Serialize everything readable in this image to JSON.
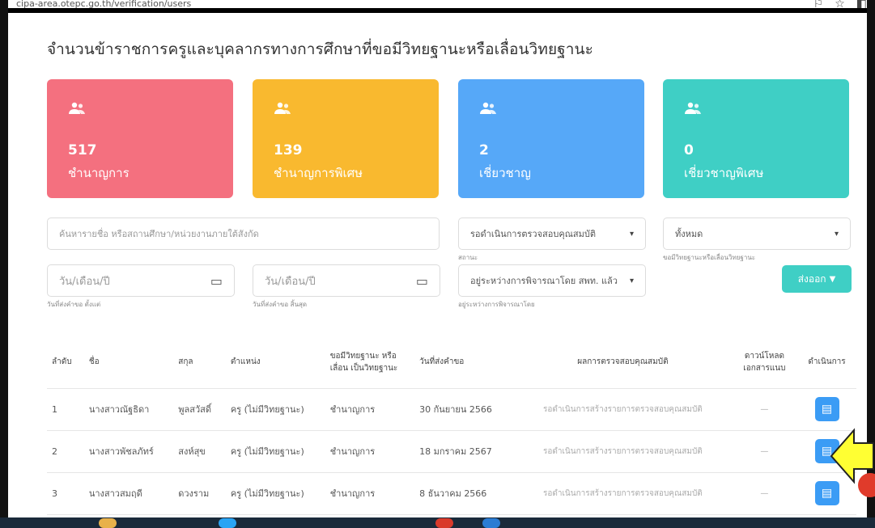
{
  "browser": {
    "url": "cipa-area.otepc.go.th/verification/users"
  },
  "page": {
    "title": "จำนวนข้าราชการครูและบุคลากรทางการศึกษาที่ขอมีวิทยฐานะหรือเลื่อนวิทยฐานะ"
  },
  "cards": [
    {
      "count": "517",
      "label": "ชำนาญการ",
      "color": "#f4707f"
    },
    {
      "count": "139",
      "label": "ชำนาญการพิเศษ",
      "color": "#f9b92f"
    },
    {
      "count": "2",
      "label": "เชี่ยวชาญ",
      "color": "#56a8f8"
    },
    {
      "count": "0",
      "label": "เชี่ยวชาญพิเศษ",
      "color": "#3fcfc5"
    }
  ],
  "filters": {
    "search_placeholder": "ค้นหารายชื่อ หรือสถานศึกษา/หน่วยงานภายใต้สังกัด",
    "status_value": "รอดำเนินการตรวจสอบคุณสมบัติ",
    "status_hint": "สถานะ",
    "level_value": "ทั้งหมด",
    "level_hint": "ขอมีวิทยฐานะหรือเลื่อนวิทยฐานะ",
    "date_from_placeholder": "วัน/เดือน/ปี",
    "date_from_hint": "วันที่ส่งคำขอ ตั้งแต่",
    "date_to_placeholder": "วัน/เดือน/ปี",
    "date_to_hint": "วันที่ส่งคำขอ สิ้นสุด",
    "review_value": "อยู่ระหว่างการพิจารณาโดย สพท. แล้ว",
    "review_hint": "อยู่ระหว่างการพิจารณาโดย",
    "export_label": "ส่งออก"
  },
  "table": {
    "headers": [
      "ลำดับ",
      "ชื่อ",
      "สกุล",
      "ตำแหน่ง",
      "ขอมีวิทยฐานะ หรือเลื่อน เป็นวิทยฐานะ",
      "วันที่ส่งคำขอ",
      "ผลการตรวจสอบคุณสมบัติ",
      "ดาวน์โหลด เอกสารแนบ",
      "ดำเนินการ"
    ],
    "rows": [
      {
        "no": "1",
        "name": "นางสาวณัฐธิดา",
        "surname": "พูลสวัสดิ์",
        "position": "ครู (ไม่มีวิทยฐานะ)",
        "level": "ชำนาญการ",
        "date": "30 กันยายน 2566",
        "status": "รอดำเนินการสร้างรายการตรวจสอบคุณสมบัติ",
        "download": "—"
      },
      {
        "no": "2",
        "name": "นางสาวพัชลภัทร์",
        "surname": "สงห์สุข",
        "position": "ครู (ไม่มีวิทยฐานะ)",
        "level": "ชำนาญการ",
        "date": "18 มกราคม 2567",
        "status": "รอดำเนินการสร้างรายการตรวจสอบคุณสมบัติ",
        "download": "—"
      },
      {
        "no": "3",
        "name": "นางสาวสมฤดี",
        "surname": "ดวงราม",
        "position": "ครู (ไม่มีวิทยฐานะ)",
        "level": "ชำนาญการ",
        "date": "8 ธันวาคม 2566",
        "status": "รอดำเนินการสร้างรายการตรวจสอบคุณสมบัติ",
        "download": "—"
      }
    ]
  }
}
